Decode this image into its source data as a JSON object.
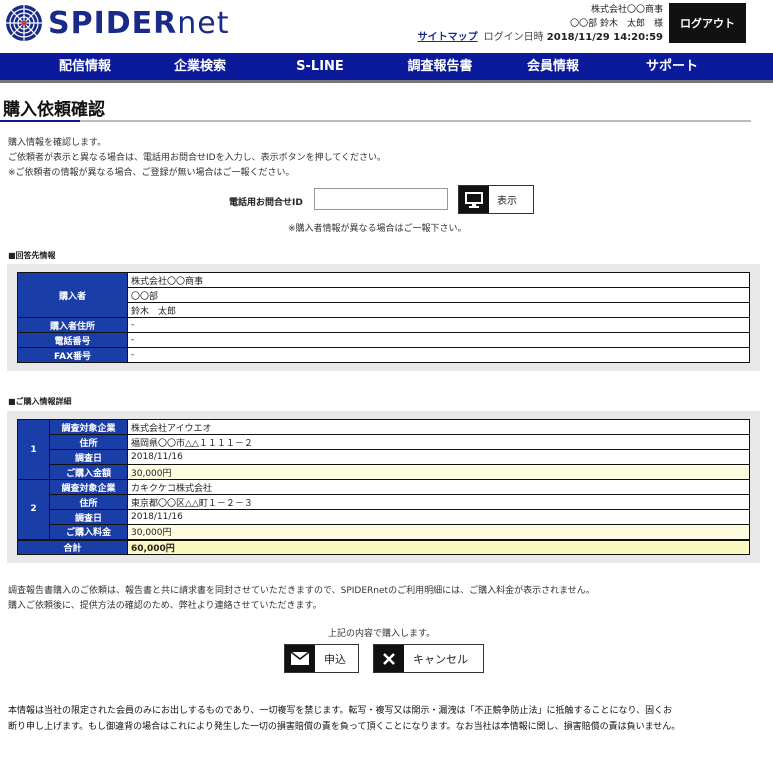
{
  "header": {
    "logo_text_a": "SPIDER",
    "logo_text_b": "net",
    "company": "株式会社〇〇商事",
    "username": "〇〇部 鈴木　太郎　様",
    "sitemap": "サイトマップ",
    "login_label": "ログイン日時",
    "login_time": "2018/11/29 14:20:59",
    "logout": "ログアウト"
  },
  "nav": [
    "配信情報",
    "企業検索",
    "S-LINE",
    "調査報告書",
    "会員情報",
    "サポート"
  ],
  "page_title": "購入依頼確認",
  "intro": [
    "購入情報を確認します。",
    "ご依頼者が表示と異なる場合は、電話用お問合せIDを入力し、表示ボタンを押してください。",
    "※ご依頼者の情報が異なる場合、ご登録が無い場合はご一報ください。"
  ],
  "phone": {
    "label": "電話用お問合せID",
    "value": "",
    "placeholder": "",
    "show_button": "表示",
    "note": "※購入者情報が異なる場合はご一報下さい。"
  },
  "reply_section": {
    "label": "■回答先情報",
    "buyer_label": "購入者",
    "buyer_lines": [
      "株式会社〇〇商事",
      "〇〇部",
      "鈴木　太郎"
    ],
    "address_label": "購入者住所",
    "address": "-",
    "phone_label": "電話番号",
    "phone": "-",
    "fax_label": "FAX番号",
    "fax": "-"
  },
  "purchase_section": {
    "label": "■ご購入情報詳細",
    "items": [
      {
        "no": "1",
        "company_label": "調査対象企業",
        "company": "株式会社アイウエオ",
        "address_label": "住所",
        "address": "福岡県〇〇市△△１１１１－２",
        "date_label": "調査日",
        "date": "2018/11/16",
        "price_label": "ご購入金額",
        "price": "30,000円"
      },
      {
        "no": "2",
        "company_label": "調査対象企業",
        "company": "カキクケコ株式会社",
        "address_label": "住所",
        "address": "東京都〇〇区△△町１－２－３",
        "date_label": "調査日",
        "date": "2018/11/16",
        "price_label": "ご購入料金",
        "price": "30,000円"
      }
    ],
    "total_label": "合計",
    "total": "60,000円"
  },
  "bottom_note": [
    "調査報告書購入のご依頼は、報告書と共に請求書を同封させていただきますので、SPIDERnetのご利用明細には、ご購入料金が表示されません。",
    "購入ご依頼後に、提供方法の確認のため、弊社より連絡させていただきます。"
  ],
  "confirm_text": "上記の内容で購入します。",
  "buttons": {
    "apply": "申込",
    "cancel": "キャンセル"
  },
  "disclaimer": [
    "本情報は当社の限定された会員のみにお出しするものであり、一切複写を禁じます。転写・複写又は開示・漏洩は「不正競争防止法」に抵触することになり、固くお",
    "断り申し上げます。もし御違背の場合はこれにより発生した一切の損害賠償の責を負って頂くことになります。なお当社は本情報に関し、損害賠償の責は負いません。"
  ],
  "colors": {
    "nav": "#0a1a9a",
    "table_header": "#1a3ea8",
    "total_bg": "#fbf7bf"
  }
}
